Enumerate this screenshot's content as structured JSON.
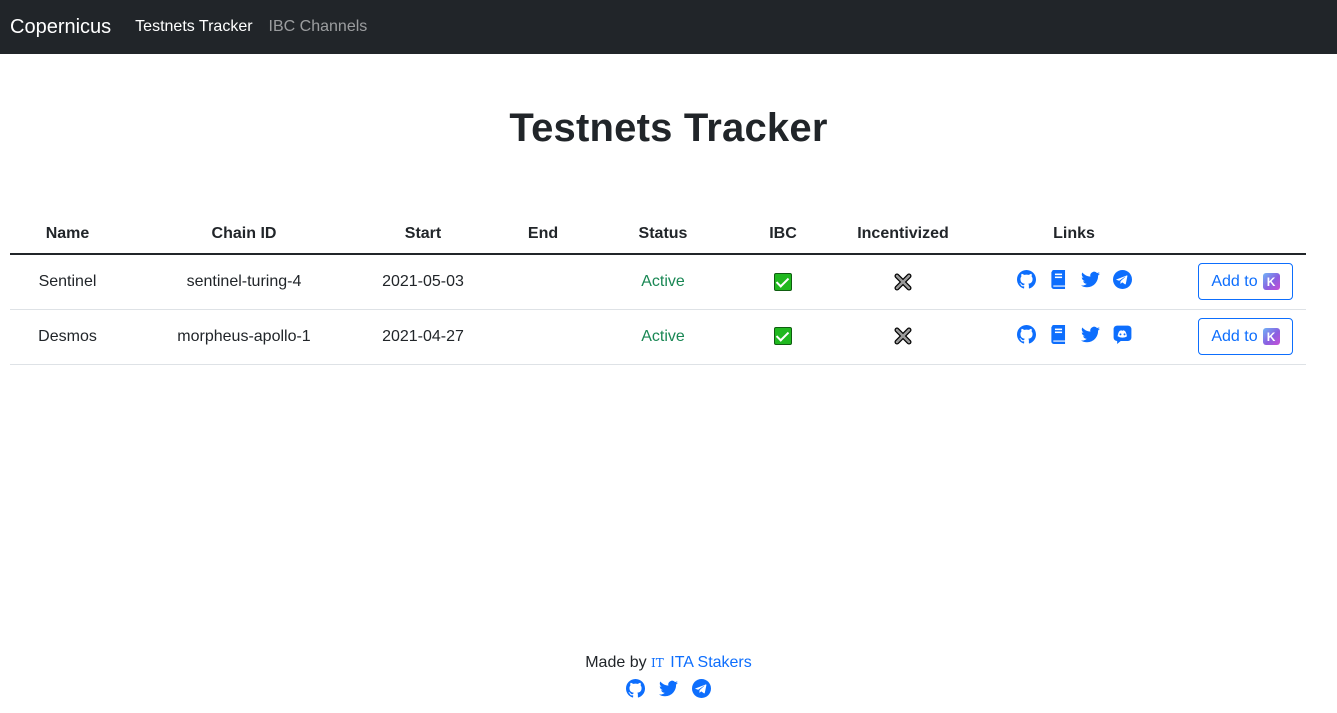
{
  "navbar": {
    "brand": "Copernicus",
    "links": [
      {
        "label": "Testnets Tracker",
        "active": true
      },
      {
        "label": "IBC Channels",
        "active": false
      }
    ]
  },
  "page": {
    "title": "Testnets Tracker"
  },
  "table": {
    "headers": [
      "Name",
      "Chain ID",
      "Start",
      "End",
      "Status",
      "IBC",
      "Incentivized",
      "Links",
      ""
    ],
    "rows": [
      {
        "name": "Sentinel",
        "chain_id": "sentinel-turing-4",
        "start": "2021-05-03",
        "end": "",
        "status": "Active",
        "ibc": "check-icon",
        "incentivized": "cross-icon",
        "links": [
          "github-icon",
          "book-icon",
          "twitter-icon",
          "telegram-icon"
        ],
        "action": "Add to"
      },
      {
        "name": "Desmos",
        "chain_id": "morpheus-apollo-1",
        "start": "2021-04-27",
        "end": "",
        "status": "Active",
        "ibc": "check-icon",
        "incentivized": "cross-icon",
        "links": [
          "github-icon",
          "book-icon",
          "twitter-icon",
          "discord-icon"
        ],
        "action": "Add to"
      }
    ]
  },
  "footer": {
    "made_by": "Made by",
    "logo_glyph": "IT",
    "brand": "ITA Stakers",
    "icons": [
      "github-icon",
      "twitter-icon",
      "telegram-icon"
    ]
  },
  "colors": {
    "navbar_bg": "#212529",
    "link_blue": "#0d6efd",
    "status_green": "#198754",
    "ibc_green": "#20b81f"
  }
}
